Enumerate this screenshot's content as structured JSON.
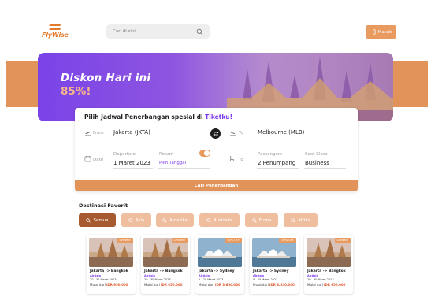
{
  "header": {
    "logo_text": "FlyWise",
    "search_placeholder": "Cari di sini ...",
    "login_label": "Masuk"
  },
  "hero": {
    "title": "Diskon Hari ini",
    "discount": "85%!"
  },
  "booking": {
    "title_prefix": "Pilih Jadwal Penerbangan spesial di ",
    "title_accent": "Tiketku!",
    "from_label": "From",
    "from_value": "Jakarta (JKTA)",
    "to_label": "To",
    "to_value": "Melbourne (MLB)",
    "date_label": "Date",
    "departure_label": "Departure",
    "departure_value": "1 Maret 2023",
    "return_label": "Return",
    "return_value": "Pilih Tanggal",
    "return_toggle_on": true,
    "seat_row_label": "To",
    "passengers_label": "Passengers",
    "passengers_value": "2 Penumpang",
    "seat_class_label": "Seat Class",
    "seat_class_value": "Business",
    "submit_label": "Cari Penerbangan"
  },
  "favorites": {
    "title": "Destinasi Favorit",
    "chips": [
      {
        "label": "Semua",
        "active": true
      },
      {
        "label": "Asia",
        "active": false
      },
      {
        "label": "Amerika",
        "active": false
      },
      {
        "label": "Australia",
        "active": false
      },
      {
        "label": "Eropa",
        "active": false
      },
      {
        "label": "Afrika",
        "active": false
      }
    ],
    "cards": [
      {
        "badge": "Limited!",
        "route": "Jakarta -> Bangkok",
        "airline": "AirAsia",
        "dates": "20 - 30 Maret 2023",
        "price_prefix": "Mulai dari ",
        "price": "IDR 950.000",
        "scene": "temple"
      },
      {
        "badge": "Limited!",
        "route": "Jakarta -> Bangkok",
        "airline": "AirAsia",
        "dates": "20 - 30 Maret 2023",
        "price_prefix": "Mulai dari ",
        "price": "IDR 950.000",
        "scene": "temple"
      },
      {
        "badge": "50% OFF",
        "route": "Jakarta -> Sydney",
        "airline": "AirAsia",
        "dates": "5 - 25 Maret 2023",
        "price_prefix": "Mulai dari ",
        "price": "IDR 3.650.000",
        "scene": "opera"
      },
      {
        "badge": "50% OFF",
        "route": "Jakarta -> Sydney",
        "airline": "AirAsia",
        "dates": "5 - 25 Maret 2023",
        "price_prefix": "Mulai dari ",
        "price": "IDR 3.650.000",
        "scene": "opera"
      },
      {
        "badge": "Limited!",
        "route": "Jakarta -> Bangkok",
        "airline": "AirAsia",
        "dates": "20 - 30 Maret 2023",
        "price_prefix": "Mulai dari ",
        "price": "IDR 950.000",
        "scene": "temple"
      }
    ]
  },
  "colors": {
    "brand_orange": "#e1935a",
    "accent_purple": "#7c3aed",
    "chip_active": "#a75a2f",
    "chip_inactive": "#eebe9f",
    "price_red": "#e0552d"
  },
  "icons": [
    "fw-logo-icon",
    "search-icon",
    "login-icon",
    "plane-takeoff-icon",
    "swap-icon",
    "plane-landing-icon",
    "calendar-icon",
    "seat-icon",
    "chip-search-icon"
  ]
}
